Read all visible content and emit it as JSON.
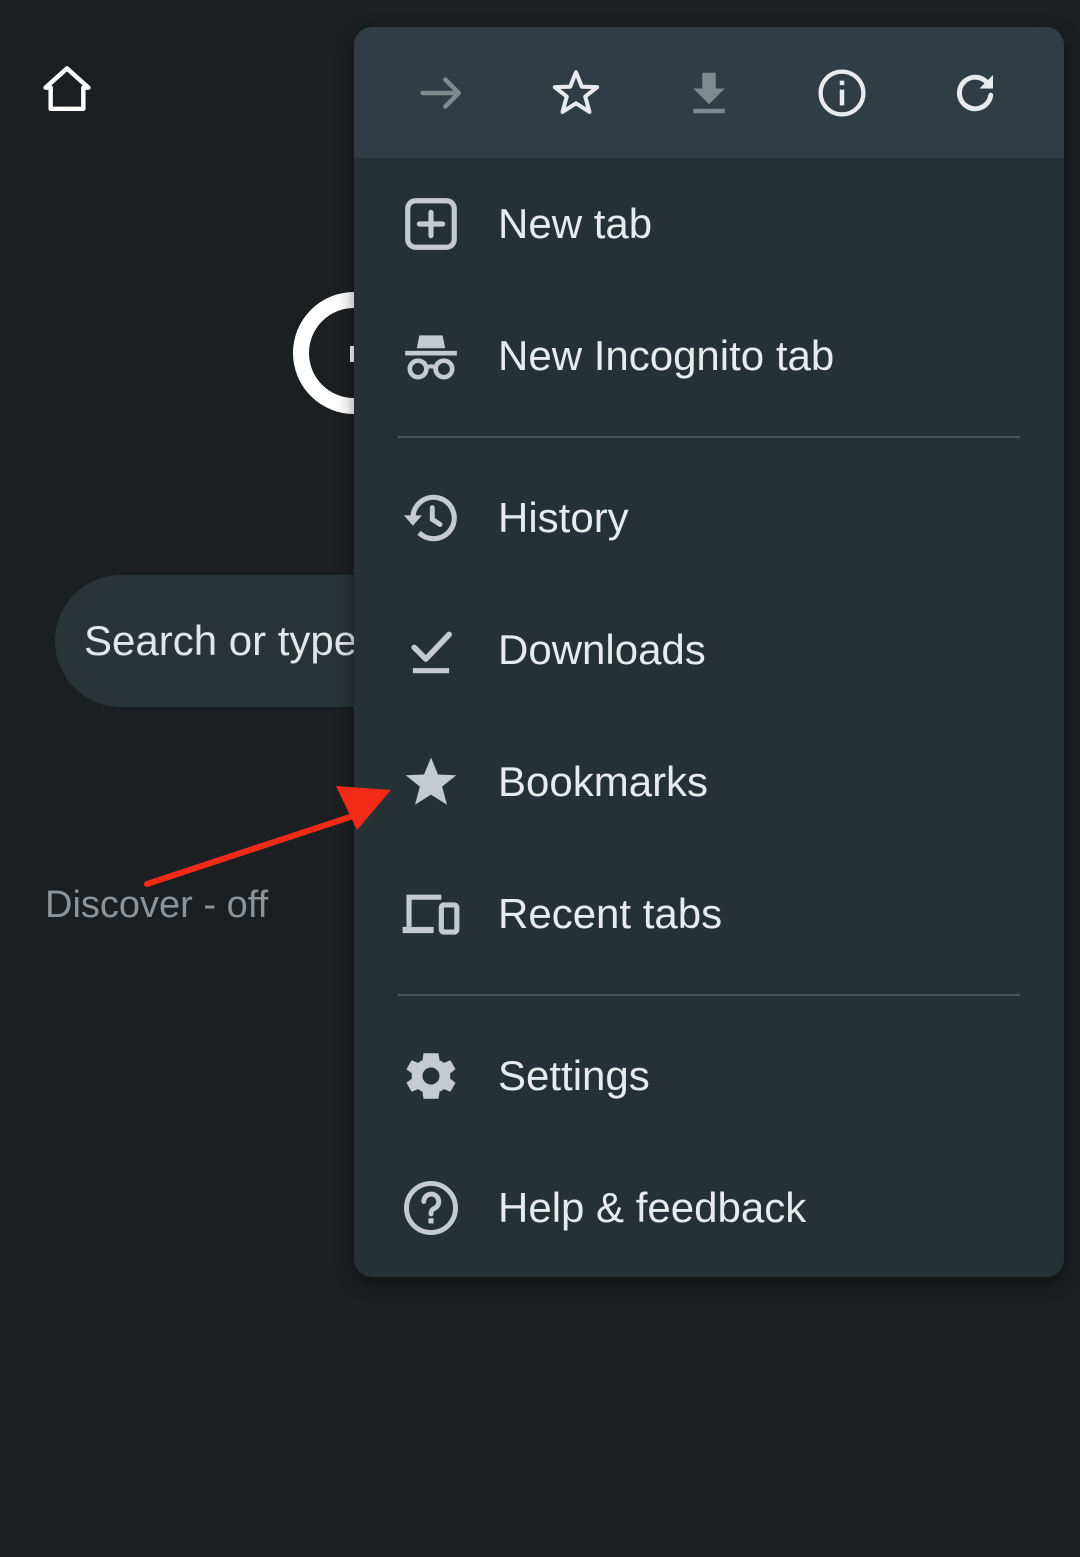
{
  "background": {
    "search_placeholder": "Search or type",
    "discover_label": "Discover - off"
  },
  "menu": {
    "toolbar": [
      {
        "name": "forward-button",
        "icon": "arrow-forward-icon",
        "enabled": false
      },
      {
        "name": "bookmark-star-button",
        "icon": "star-outline-icon",
        "enabled": true
      },
      {
        "name": "download-page-button",
        "icon": "download-icon",
        "enabled": false
      },
      {
        "name": "page-info-button",
        "icon": "info-icon",
        "enabled": true
      },
      {
        "name": "reload-button",
        "icon": "refresh-icon",
        "enabled": true
      }
    ],
    "items": {
      "new_tab": "New tab",
      "new_incognito_tab": "New Incognito tab",
      "history": "History",
      "downloads": "Downloads",
      "bookmarks": "Bookmarks",
      "recent_tabs": "Recent tabs",
      "settings": "Settings",
      "help_feedback": "Help & feedback"
    }
  },
  "colors": {
    "page_bg": "#1c1f21",
    "menu_bg": "#263136",
    "toolbar_bg": "#2e3e44",
    "annotation_arrow": "#f22a17",
    "icon_enabled": "#e8ebed",
    "icon_disabled": "#7d8a8e"
  }
}
